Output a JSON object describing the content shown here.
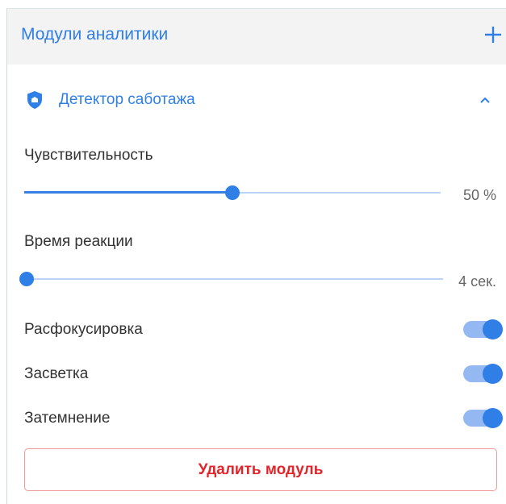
{
  "panel": {
    "title": "Модули аналитики",
    "add_icon": "plus-icon"
  },
  "module": {
    "icon": "shield-icon",
    "title": "Детектор саботажа",
    "expanded": true,
    "collapse_icon": "chevron-up-icon"
  },
  "sensitivity": {
    "label": "Чувствительность",
    "value_text": "50 %",
    "value_fraction": 0.5
  },
  "reaction_time": {
    "label": "Время реакции",
    "value_text": "4 сек.",
    "value_fraction": 0.0
  },
  "toggles": [
    {
      "label": "Расфокусировка",
      "on": true
    },
    {
      "label": "Засветка",
      "on": true
    },
    {
      "label": "Затемнение",
      "on": true
    }
  ],
  "delete_button": {
    "label": "Удалить модуль"
  },
  "colors": {
    "accent": "#2f7fe6",
    "slider_track": "#b9d4f7",
    "toggle_track": "#93b8f2",
    "danger": "#e0252b",
    "danger_border": "#f09a9a",
    "header_bg": "#f3f3f3"
  }
}
